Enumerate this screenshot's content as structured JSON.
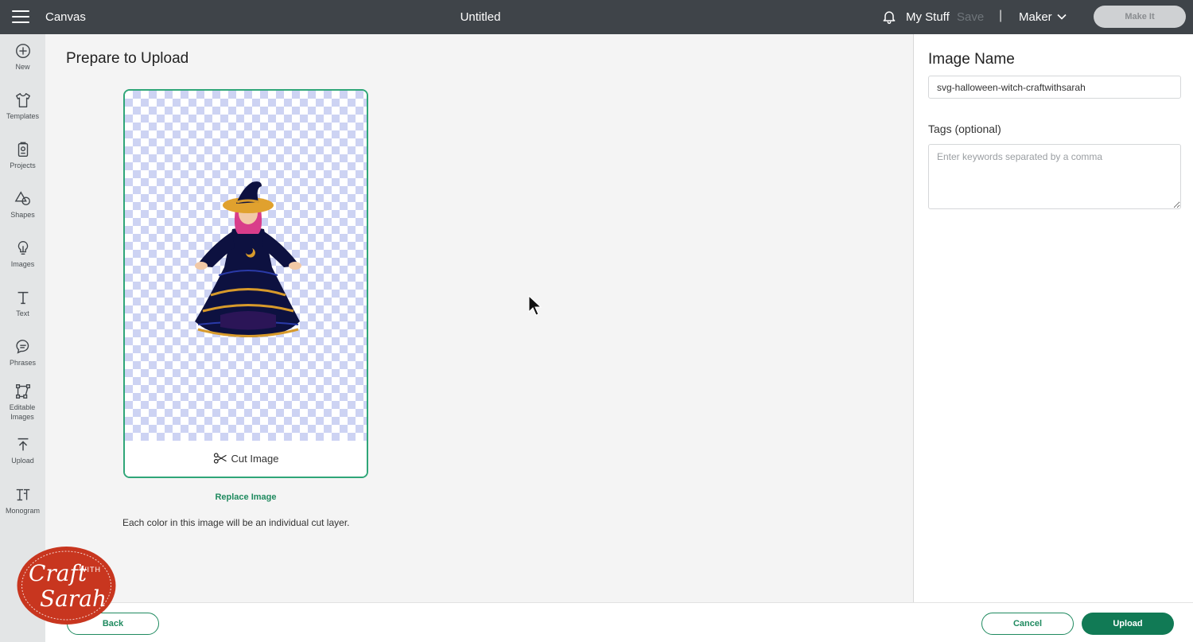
{
  "topbar": {
    "app_name": "Canvas",
    "doc_title": "Untitled",
    "my_stuff": "My Stuff",
    "save": "Save",
    "separator": "|",
    "machine": "Maker",
    "make_it": "Make It"
  },
  "sidebar": {
    "items": [
      {
        "label": "New",
        "icon": "plus-circle-icon"
      },
      {
        "label": "Templates",
        "icon": "shirt-icon"
      },
      {
        "label": "Projects",
        "icon": "projects-icon"
      },
      {
        "label": "Shapes",
        "icon": "shapes-icon"
      },
      {
        "label": "Images",
        "icon": "lightbulb-icon"
      },
      {
        "label": "Text",
        "icon": "text-icon"
      },
      {
        "label": "Phrases",
        "icon": "speech-bubble-icon"
      },
      {
        "label": "Editable Images",
        "icon": "editable-images-icon"
      },
      {
        "label": "Upload",
        "icon": "upload-icon"
      },
      {
        "label": "Monogram",
        "icon": "monogram-icon"
      }
    ]
  },
  "main": {
    "title": "Prepare to Upload",
    "cut_label": "Cut Image",
    "replace_label": "Replace Image",
    "note": "Each color in this image will be an individual cut layer."
  },
  "right_panel": {
    "image_name_title": "Image Name",
    "image_name_value": "svg-halloween-witch-craftwithsarah",
    "tags_label": "Tags (optional)",
    "tags_placeholder": "Enter keywords separated by a comma"
  },
  "footer": {
    "back": "Back",
    "cancel": "Cancel",
    "upload": "Upload"
  },
  "logo": {
    "line1": "Craft",
    "with": "WITH",
    "line2": "Sarah"
  },
  "colors": {
    "accent": "#117a55",
    "topbar": "#3f4449",
    "logo_red": "#c8361f"
  }
}
